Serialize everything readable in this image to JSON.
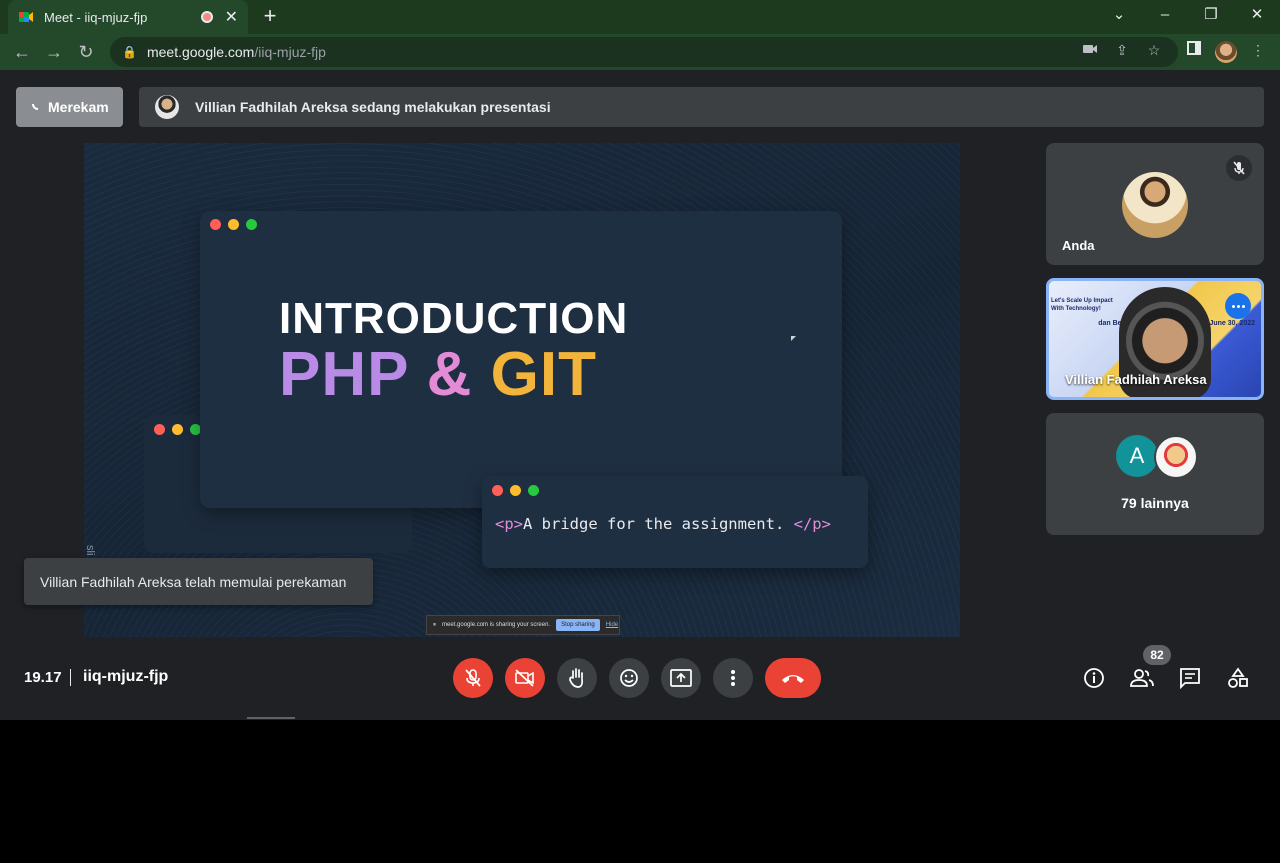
{
  "browser": {
    "tab_title": "Meet - iiq-mjuz-fjp",
    "new_tab_symbol": "+",
    "url_host": "meet.google.com",
    "url_path": "/iiq-mjuz-fjp"
  },
  "meet": {
    "recording_label": "Merekam",
    "presenter_banner": "Villian Fadhilah Areksa sedang melakukan presentasi",
    "toast": "Villian Fadhilah Areksa telah memulai perekaman",
    "time": "19.17",
    "meeting_code": "iiq-mjuz-fjp",
    "participant_count": "82"
  },
  "slide": {
    "title_line1": "INTRODUCTION",
    "php": "PHP",
    "amp": "&",
    "git": "GIT",
    "code_open": "<p>",
    "code_text": "A bridge for the assignment. ",
    "code_close": "</p>",
    "side_text": "sli        .com",
    "share_message": "meet.google.com is sharing your screen.",
    "stop_sharing": "Stop sharing",
    "hide": "Hide"
  },
  "tiles": {
    "you": "Anda",
    "presenter": "Villian Fadhilah Areksa",
    "presenter_bg_text_left": "Let's Scale Up Impact With Technology!",
    "presenter_bg_text_right": "dan Bersertifikat · TS Indonesia · June 30, 2022",
    "others_initial": "A",
    "others_label": "79 lainnya"
  },
  "colors": {
    "accent_blue": "#8ab4f8",
    "danger_red": "#ea4335",
    "chrome_green": "#24482a"
  }
}
